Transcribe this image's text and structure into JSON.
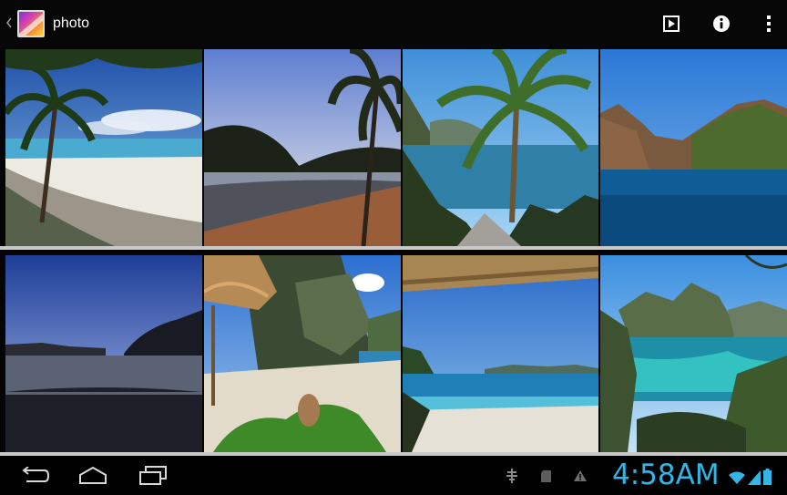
{
  "action_bar": {
    "title": "photo",
    "icons": [
      "up-caret-icon",
      "gallery-app-icon",
      "slideshow-icon",
      "info-icon",
      "overflow-menu-icon"
    ]
  },
  "grid": {
    "columns": 4,
    "rows": 2,
    "photos": [
      {
        "subject": "beach-palm-tree"
      },
      {
        "subject": "sunset-bay-palm"
      },
      {
        "subject": "palm-lagoon"
      },
      {
        "subject": "limestone-cliffs-sea"
      },
      {
        "subject": "dusk-horizon"
      },
      {
        "subject": "cove-hut-plants"
      },
      {
        "subject": "beach-from-hut"
      },
      {
        "subject": "lagoon-islands"
      }
    ]
  },
  "system_bar": {
    "clock": "4:58AM",
    "accent_color": "#33b5e5",
    "nav_icons": [
      "back-icon",
      "home-icon",
      "recents-icon"
    ],
    "notification_icons": [
      "usb-debug-icon",
      "sd-card-icon",
      "warning-icon"
    ],
    "status_icons": [
      "wifi-icon",
      "signal-icon",
      "battery-icon"
    ]
  }
}
